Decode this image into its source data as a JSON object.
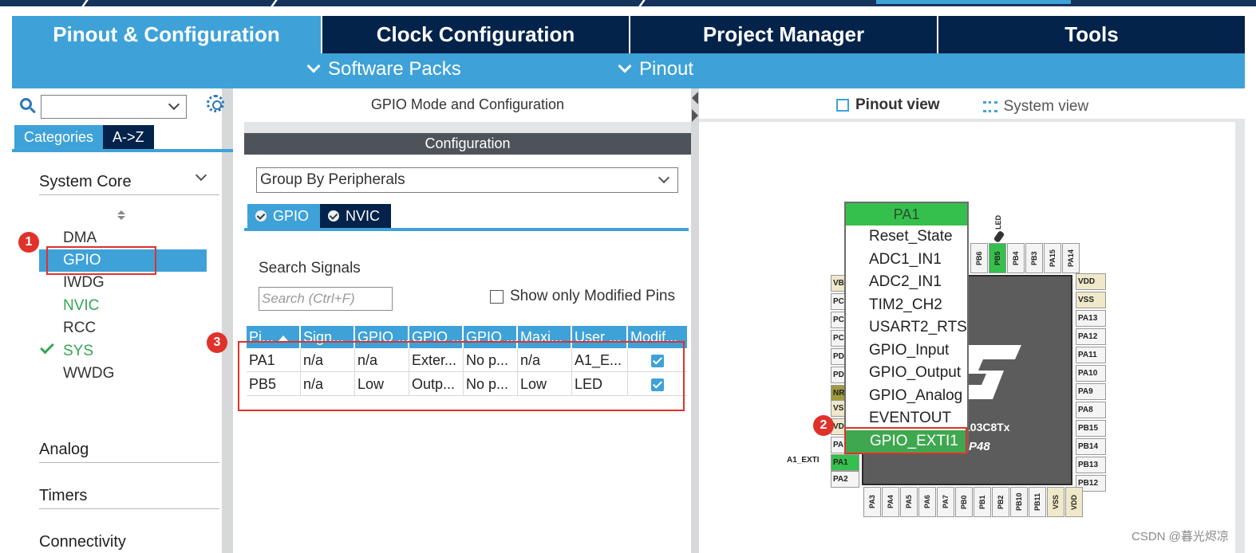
{
  "main_tabs": [
    {
      "label": "Pinout & Configuration",
      "active": true
    },
    {
      "label": "Clock Configuration",
      "active": false
    },
    {
      "label": "Project Manager",
      "active": false
    },
    {
      "label": "Tools",
      "active": false
    }
  ],
  "sub_menus": [
    "Software Packs",
    "Pinout"
  ],
  "left_panel": {
    "category_tabs": [
      "Categories",
      "A->Z"
    ],
    "sections": [
      "System Core",
      "Analog",
      "Timers",
      "Connectivity"
    ],
    "peripherals": [
      {
        "label": "DMA",
        "state": "normal"
      },
      {
        "label": "GPIO",
        "state": "selected"
      },
      {
        "label": "IWDG",
        "state": "normal"
      },
      {
        "label": "NVIC",
        "state": "green"
      },
      {
        "label": "RCC",
        "state": "normal"
      },
      {
        "label": "SYS",
        "state": "checked"
      },
      {
        "label": "WWDG",
        "state": "normal"
      }
    ]
  },
  "middle_panel": {
    "title": "GPIO Mode and Configuration",
    "config_header": "Configuration",
    "group_by": "Group By Peripherals",
    "sub_tabs": [
      "GPIO",
      "NVIC"
    ],
    "search_label": "Search Signals",
    "search_placeholder": "Search (Ctrl+F)",
    "show_modified_label": "Show only Modified Pins",
    "table": {
      "headers": [
        "Pi...",
        "Sign...",
        "GPIO ...",
        "GPIO ...",
        "GPIO ...",
        "Maxi...",
        "User ...",
        "Modif..."
      ],
      "rows": [
        [
          "PA1",
          "n/a",
          "n/a",
          "Exter...",
          "No p...",
          "n/a",
          "A1_E...",
          true
        ],
        [
          "PB5",
          "n/a",
          "Low",
          "Outp...",
          "No p...",
          "Low",
          "LED",
          true
        ]
      ]
    }
  },
  "right_panel": {
    "view_tabs": [
      "Pinout view",
      "System view"
    ],
    "chip_name": "103C8Tx",
    "chip_package": "P48",
    "a1_label": "A1_EXTI",
    "led_label": "LED",
    "pins_right": [
      "VDD",
      "VSS",
      "PA13",
      "PA12",
      "PA11",
      "PA10",
      "PA9",
      "PA8",
      "PB15",
      "PB14",
      "PB13",
      "PB12"
    ],
    "pins_left": [
      "VB",
      "PC",
      "PC",
      "PC",
      "PD",
      "PD",
      "NR",
      "VS",
      "VD",
      "PA",
      "PA1",
      "PA2"
    ],
    "pins_top": [
      "PB6",
      "PB5",
      "PB4",
      "PB3",
      "PA15",
      "PA14"
    ],
    "pins_bottom": [
      "PA3",
      "PA4",
      "PA5",
      "PA6",
      "PA7",
      "PB0",
      "PB1",
      "PB2",
      "PB10",
      "PB11",
      "VSS",
      "VDD"
    ]
  },
  "popup": {
    "header": "PA1",
    "items": [
      "Reset_State",
      "ADC1_IN1",
      "ADC2_IN1",
      "TIM2_CH2",
      "USART2_RTS",
      "GPIO_Input",
      "GPIO_Output",
      "GPIO_Analog",
      "EVENTOUT",
      "GPIO_EXTI1"
    ],
    "selected": "GPIO_EXTI1"
  },
  "badges": [
    "1",
    "2",
    "3"
  ],
  "watermark": "CSDN @暮光烬凉",
  "colors": {
    "accent": "#3ea2d8",
    "navy": "#03234b",
    "green": "#35c04d",
    "red": "#e0312b"
  }
}
